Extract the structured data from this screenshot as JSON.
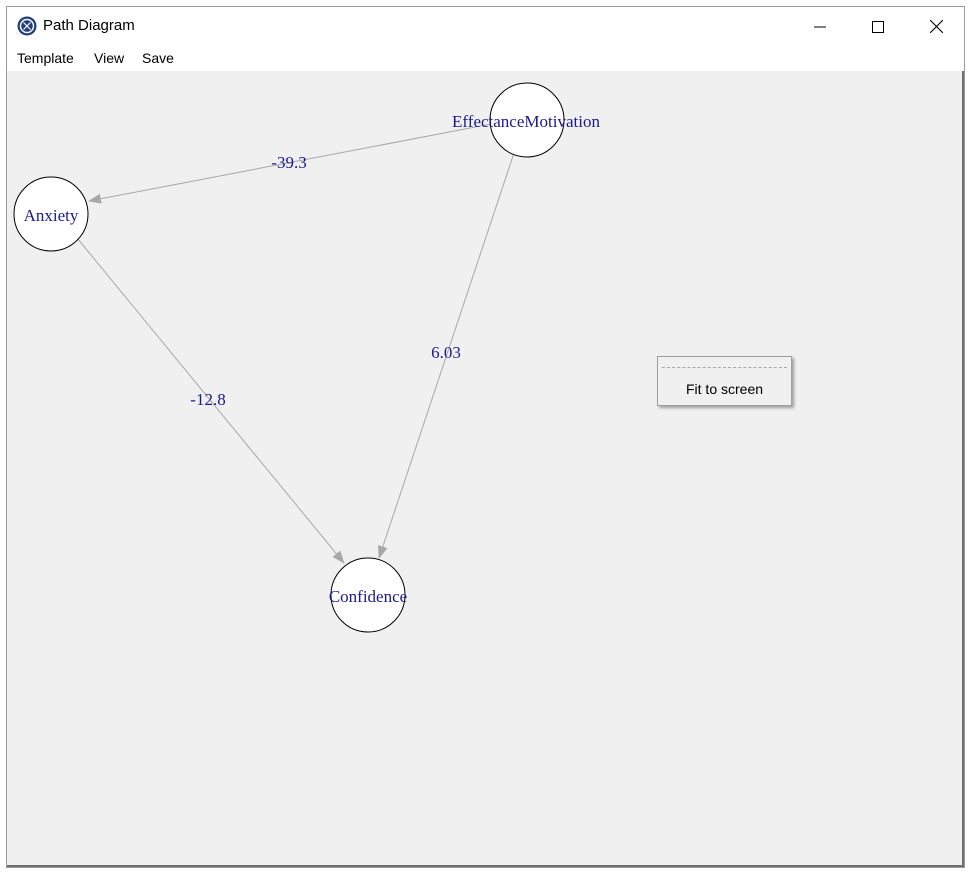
{
  "window": {
    "title": "Path Diagram",
    "icon": "r-logo-icon"
  },
  "menu": {
    "items": [
      "Template",
      "View",
      "Save"
    ]
  },
  "diagram": {
    "nodes": [
      {
        "id": "effectance",
        "label": "EffectanceMotivation"
      },
      {
        "id": "anxiety",
        "label": "Anxiety"
      },
      {
        "id": "confidence",
        "label": "Confidence"
      }
    ],
    "edges": [
      {
        "from": "effectance",
        "to": "anxiety",
        "label": "-39.3"
      },
      {
        "from": "effectance",
        "to": "confidence",
        "label": "6.03"
      },
      {
        "from": "anxiety",
        "to": "confidence",
        "label": "-12.8"
      }
    ],
    "colors": {
      "label": "#1a1a8c",
      "edge": "#a8a8a8",
      "node_fill": "#ffffff",
      "node_stroke": "#000000"
    }
  },
  "context_menu": {
    "items": [
      "Fit to screen"
    ]
  }
}
